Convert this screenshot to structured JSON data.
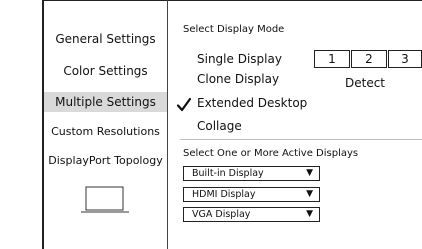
{
  "sidebar": {
    "items": [
      {
        "label": "General Settings"
      },
      {
        "label": "Color Settings"
      },
      {
        "label": "Multiple Settings"
      },
      {
        "label": "Custom Resolutions"
      },
      {
        "label": "DisplayPort Topology"
      }
    ]
  },
  "main": {
    "mode_header": "Select Display Mode",
    "modes": [
      {
        "label": "Single Display"
      },
      {
        "label": "Clone Display"
      },
      {
        "label": "Extended Desktop",
        "checked": true
      },
      {
        "label": "Collage"
      }
    ],
    "monitors": [
      "1",
      "2",
      "3"
    ],
    "detect_label": "Detect",
    "active_header": "Select One or More Active Displays",
    "displays": [
      {
        "label": "Built-in Display"
      },
      {
        "label": "HDMI Display"
      },
      {
        "label": "VGA Display"
      }
    ]
  },
  "icons": {
    "check": "checkmark-icon",
    "dropdown": "triangle-down-icon",
    "laptop": "laptop-icon"
  }
}
